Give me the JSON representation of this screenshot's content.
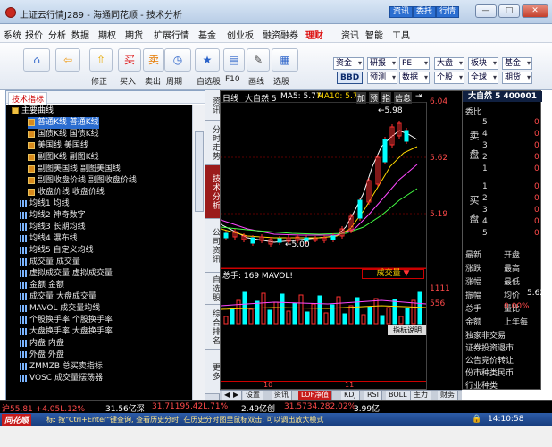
{
  "window": {
    "title": "上证云行情J289 - 海通同花顺 - 技术分析",
    "top_buttons": [
      "资讯",
      "委托",
      "行情"
    ],
    "controls": {
      "minimize": "—",
      "maximize": "□",
      "close": "✕"
    }
  },
  "menu": [
    "系统",
    "报价",
    "分析",
    "数据",
    "期权",
    "期货",
    "扩展行情",
    "基金",
    "创业板",
    "融资融券",
    "理财",
    "资讯",
    "智能",
    "工具"
  ],
  "menu_highlight": "理财",
  "toolbar": {
    "buttons": [
      {
        "name": "home",
        "glyph": "⌂",
        "label": ""
      },
      {
        "name": "back",
        "glyph": "⇦",
        "label": ""
      },
      {
        "name": "modify",
        "glyph": "⇧",
        "label": "修正"
      },
      {
        "name": "buy",
        "glyph": "买",
        "label": "买入"
      },
      {
        "name": "sell",
        "glyph": "卖",
        "label": "卖出"
      },
      {
        "name": "period",
        "glyph": "◷",
        "label": "周期"
      },
      {
        "name": "watchlist",
        "glyph": "★",
        "label": "自选股"
      },
      {
        "name": "f10",
        "glyph": "▤",
        "label": "F10"
      },
      {
        "name": "drawline",
        "glyph": "✎",
        "label": "画线"
      },
      {
        "name": "pickstock",
        "glyph": "▦",
        "label": "选股"
      }
    ],
    "right_combos": [
      {
        "label": "资金",
        "row": 0
      },
      {
        "label": "研报",
        "row": 0
      },
      {
        "label": "PE",
        "row": 0
      },
      {
        "label": "大盘",
        "row": 0
      },
      {
        "label": "板块",
        "row": 0
      },
      {
        "label": "基金",
        "row": 0
      },
      {
        "label": "预测",
        "row": 1
      },
      {
        "label": "数据",
        "row": 1
      },
      {
        "label": "个股",
        "row": 1
      },
      {
        "label": "全球",
        "row": 1
      },
      {
        "label": "期货",
        "row": 1
      }
    ],
    "bbd_label": "BBD"
  },
  "left_panel": {
    "header_tab": "技术指标",
    "tree": [
      {
        "icon": "fold",
        "text": "主要曲线",
        "indent": 0,
        "selected": false
      },
      {
        "icon": "curve",
        "text": "普通K线 普通K线",
        "indent": 2,
        "selected": true
      },
      {
        "icon": "curve",
        "text": "国债K线 国债K线",
        "indent": 2,
        "selected": false
      },
      {
        "icon": "curve",
        "text": "美国线 美国线",
        "indent": 2,
        "selected": false
      },
      {
        "icon": "curve",
        "text": "副图K线 副图K线",
        "indent": 2,
        "selected": false
      },
      {
        "icon": "curve",
        "text": "副图美国线 副图美国线",
        "indent": 2,
        "selected": false
      },
      {
        "icon": "curve",
        "text": "副图收盘价线 副图收盘价线",
        "indent": 2,
        "selected": false
      },
      {
        "icon": "curve",
        "text": "收盘价线 收盘价线",
        "indent": 2,
        "selected": false
      },
      {
        "icon": "bars",
        "text": "均线1 均线",
        "indent": 1,
        "selected": false
      },
      {
        "icon": "bars",
        "text": "均线2 神奇数字",
        "indent": 1,
        "selected": false
      },
      {
        "icon": "bars",
        "text": "均线3 长期均线",
        "indent": 1,
        "selected": false
      },
      {
        "icon": "bars",
        "text": "均线4 瀑布线",
        "indent": 1,
        "selected": false
      },
      {
        "icon": "bars",
        "text": "均线5 自定义均线",
        "indent": 1,
        "selected": false
      },
      {
        "icon": "bars",
        "text": "成交量 成交量",
        "indent": 1,
        "selected": false
      },
      {
        "icon": "bars",
        "text": "虚拟成交量 虚拟成交量",
        "indent": 1,
        "selected": false
      },
      {
        "icon": "bars",
        "text": "金额 金额",
        "indent": 1,
        "selected": false
      },
      {
        "icon": "bars",
        "text": "成交量 大盘成交量",
        "indent": 1,
        "selected": false
      },
      {
        "icon": "bars",
        "text": "MAVOL 成交量均线",
        "indent": 1,
        "selected": false
      },
      {
        "icon": "bars",
        "text": "个股换手率 个股换手率",
        "indent": 1,
        "selected": false
      },
      {
        "icon": "bars",
        "text": "大盘换手率 大盘换手率",
        "indent": 1,
        "selected": false
      },
      {
        "icon": "bars",
        "text": "内盘 内盘",
        "indent": 1,
        "selected": false
      },
      {
        "icon": "bars",
        "text": "外盘 外盘",
        "indent": 1,
        "selected": false
      },
      {
        "icon": "bars",
        "text": "ZMMZB 总买卖指标",
        "indent": 1,
        "selected": false
      },
      {
        "icon": "bars",
        "text": "VOSC 成交量摆荡器",
        "indent": 1,
        "selected": false
      }
    ]
  },
  "side_tabs": [
    {
      "text": "资讯",
      "active": false
    },
    {
      "text": "分时走势",
      "active": false
    },
    {
      "text": "技术分析",
      "active": true
    },
    {
      "text": "公司资讯",
      "active": false
    },
    {
      "text": "自选股",
      "active": false
    },
    {
      "text": "综合排名",
      "active": false
    },
    {
      "text": "更多",
      "active": false
    }
  ],
  "chart": {
    "header": {
      "mode": "日线",
      "stock": "大自然 5",
      "ma5": "MA5: 5.77",
      "ma10": "MA10: 5.7(",
      "tools": [
        "加",
        "预",
        "指",
        "信息",
        "⇥"
      ]
    },
    "annot_high": "5.98",
    "annot_low": "5.00",
    "price_axis": [
      "6.04",
      "5.62",
      "5.19"
    ],
    "vol_axis": [
      "1111",
      "556"
    ],
    "vol_label": "总手: 169 MAVOL!",
    "vol_dropdown": "成交量",
    "indicator_btn": "指标说明",
    "x_labels": [
      "10",
      "11"
    ],
    "bottom_tabs": [
      "◀",
      "▶",
      "设置",
      "资讯",
      "LOF净值",
      "KDJ",
      "RSI",
      "BOLL",
      "主力",
      "财务"
    ],
    "bottom_active": "LOF净值"
  },
  "orderbook": {
    "title": "大自然 5 400001",
    "wei_bi": "委比",
    "sell_label": "卖盘",
    "buy_label": "买盘",
    "sell": [
      {
        "n": "5",
        "v": "0"
      },
      {
        "n": "4",
        "v": "0"
      },
      {
        "n": "3",
        "v": "0"
      },
      {
        "n": "2",
        "v": "0"
      },
      {
        "n": "1",
        "v": "0"
      }
    ],
    "buy": [
      {
        "n": "1",
        "v": "0"
      },
      {
        "n": "2",
        "v": "0"
      },
      {
        "n": "3",
        "v": "0"
      },
      {
        "n": "4",
        "v": "0"
      },
      {
        "n": "5",
        "v": "0"
      }
    ],
    "stats": [
      {
        "l": "最新",
        "v": "开盘"
      },
      {
        "l": "涨跌",
        "v": "最高"
      },
      {
        "l": "涨幅",
        "v": "最低"
      },
      {
        "l": "振幅",
        "v": "均价"
      },
      {
        "l": "总手",
        "v": "量比"
      },
      {
        "l": "金额",
        "v": "上年每"
      }
    ],
    "right_values": [
      "5.62",
      "0.00%"
    ],
    "ad_lines": [
      "独家非交易",
      "证券投资退市",
      "公告竞价转让",
      "份市种类民币",
      "行业种类"
    ]
  },
  "status_row": {
    "sh": "沪55.81 +4.05L.12%",
    "mid": "31.56亿深",
    "sz": "31.71195.42L.71%",
    "vol2": "2.49亿创",
    "cy": "31.5734.282.02%",
    "end": "3.99亿"
  },
  "info_bar": {
    "brand": "同花顺",
    "tip": "标: 按\"Ctrl+Enter\"键查询, 查看历史分时: 在历史分时图里鼠标双击, 可以调出放大模式",
    "time": "14:10:58"
  }
}
